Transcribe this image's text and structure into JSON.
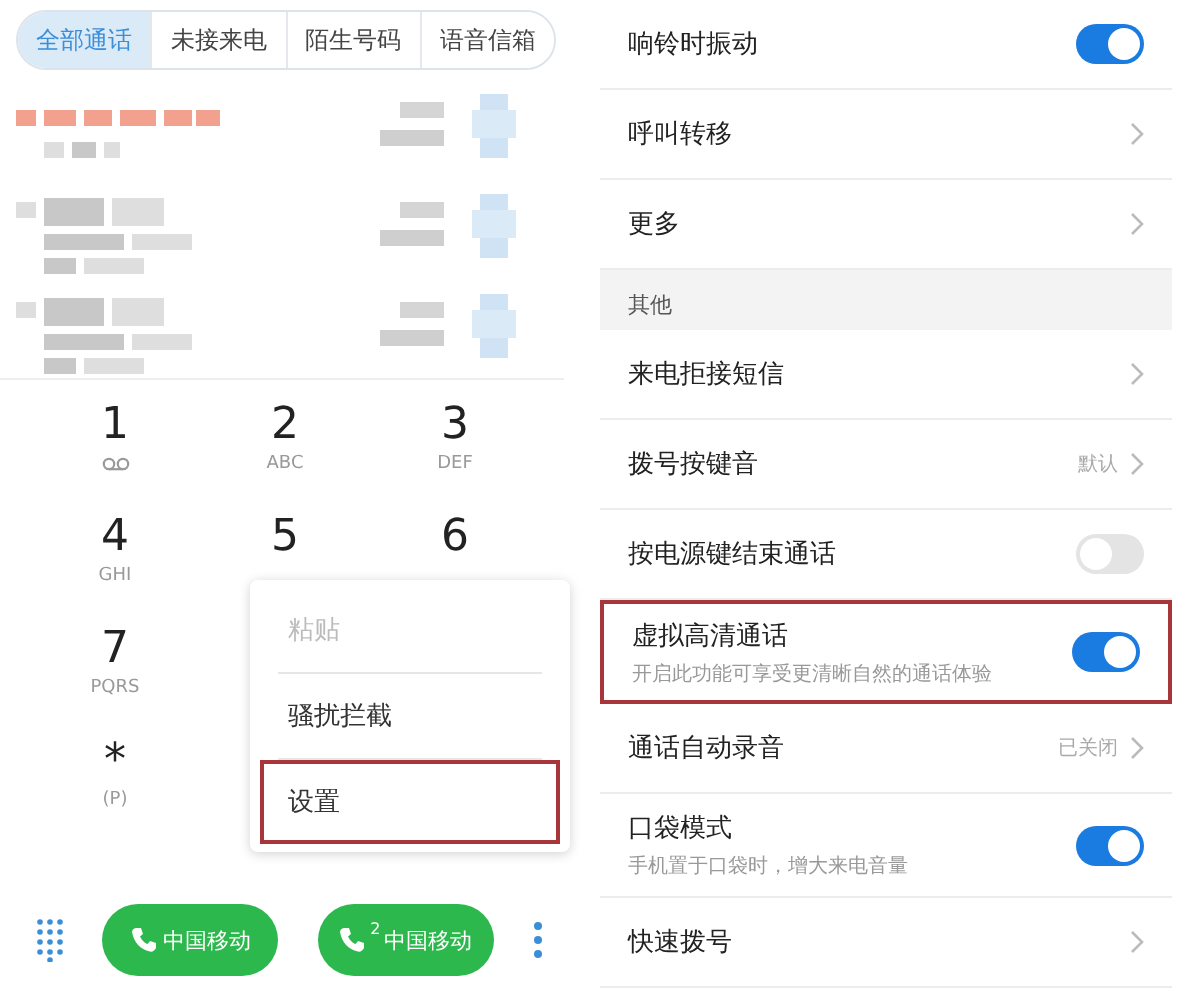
{
  "dialer": {
    "tabs": [
      {
        "label": "全部通话",
        "selected": true
      },
      {
        "label": "未接来电",
        "selected": false
      },
      {
        "label": "陌生号码",
        "selected": false
      },
      {
        "label": "语音信箱",
        "selected": false
      }
    ],
    "call_log": [
      {
        "kind": "blurred",
        "missed": true
      },
      {
        "kind": "blurred",
        "missed": false
      },
      {
        "kind": "blurred",
        "missed": false
      }
    ],
    "keypad_rows": [
      [
        {
          "kind": "voicemail",
          "digit": "1"
        },
        {
          "kind": "letters",
          "digit": "2",
          "letters": "ABC"
        },
        {
          "kind": "letters",
          "digit": "3",
          "letters": "DEF"
        }
      ],
      [
        {
          "kind": "letters",
          "digit": "4",
          "letters": "GHI"
        },
        {
          "kind": "digit",
          "digit": "5"
        },
        {
          "kind": "digit",
          "digit": "6"
        }
      ],
      [
        {
          "kind": "letters",
          "digit": "7",
          "letters": "PQRS"
        }
      ],
      [
        {
          "kind": "letters",
          "digit": "*",
          "letters": "(P)"
        }
      ]
    ],
    "menu": {
      "items": [
        {
          "label": "粘贴",
          "disabled": true,
          "highlighted": false
        },
        {
          "label": "骚扰拦截",
          "disabled": false,
          "highlighted": false
        },
        {
          "label": "设置",
          "disabled": false,
          "highlighted": true
        }
      ]
    },
    "call_buttons": [
      {
        "label": "中国移动"
      },
      {
        "label": "中国移动",
        "sim_badge": "2"
      }
    ]
  },
  "settings": [
    {
      "kind": "toggle",
      "label": "响铃时振动",
      "on": true,
      "highlighted": false
    },
    {
      "kind": "link",
      "label": "呼叫转移",
      "highlighted": false
    },
    {
      "kind": "link",
      "label": "更多",
      "highlighted": false
    },
    {
      "kind": "header",
      "label": "其他"
    },
    {
      "kind": "link",
      "label": "来电拒接短信",
      "highlighted": false
    },
    {
      "kind": "link",
      "label": "拨号按键音",
      "value": "默认",
      "highlighted": false
    },
    {
      "kind": "toggle",
      "label": "按电源键结束通话",
      "on": false,
      "highlighted": false
    },
    {
      "kind": "toggle",
      "label": "虚拟高清通话",
      "subtitle": "开启此功能可享受更清晰自然的通话体验",
      "on": true,
      "highlighted": true
    },
    {
      "kind": "link",
      "label": "通话自动录音",
      "value": "已关闭",
      "highlighted": false
    },
    {
      "kind": "toggle",
      "label": "口袋模式",
      "subtitle": "手机置于口袋时，增大来电音量",
      "on": true,
      "highlighted": false
    },
    {
      "kind": "link",
      "label": "快速拨号",
      "highlighted": false
    }
  ]
}
